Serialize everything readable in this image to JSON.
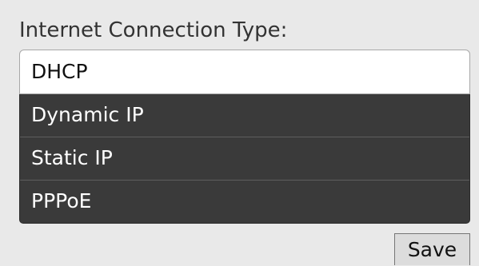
{
  "form": {
    "label": "Internet Connection Type:",
    "selected_value": "DHCP",
    "options": [
      {
        "label": "Dynamic IP"
      },
      {
        "label": "Static IP"
      },
      {
        "label": "PPPoE"
      }
    ],
    "save_label": "Save"
  },
  "colors": {
    "background": "#e9e9e9",
    "dropdown_menu": "#3a3a3a",
    "selected_field": "#ffffff"
  }
}
